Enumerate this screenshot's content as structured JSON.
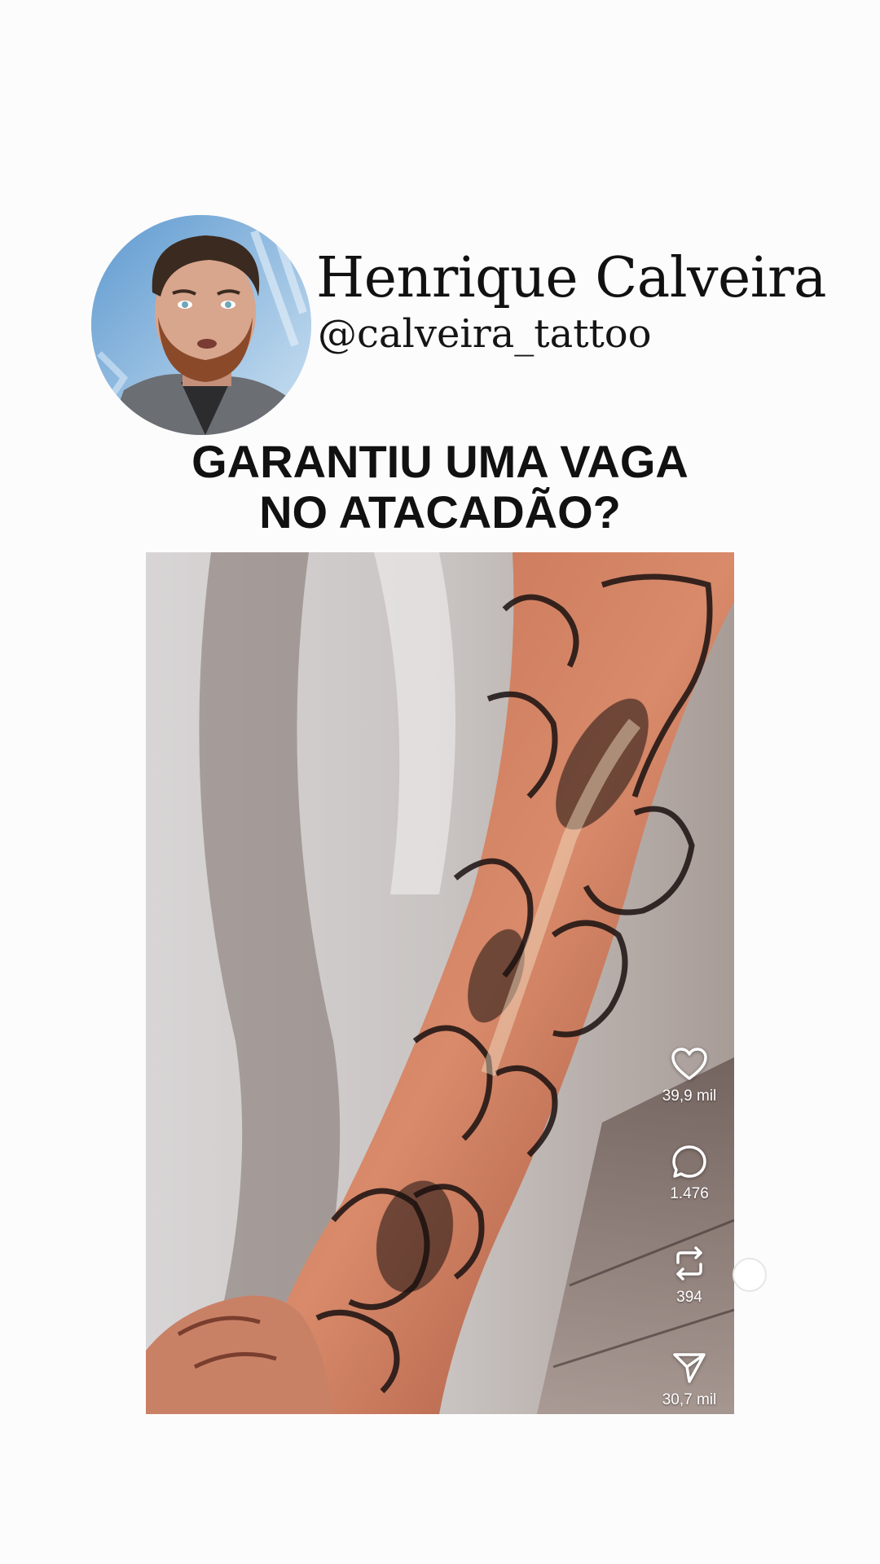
{
  "profile": {
    "name": "Henrique Calveira",
    "handle": "@calveira_tattoo"
  },
  "headline": {
    "line1": "GARANTIU UMA VAGA",
    "line2": "NO ATACADÃO?"
  },
  "video": {
    "actions": {
      "likes": "39,9 mil",
      "comments": "1.476",
      "reposts": "394",
      "shares": "30,7 mil"
    }
  },
  "icons": {
    "like": "heart-icon",
    "comment": "comment-bubble-icon",
    "repost": "repost-icon",
    "share": "send-icon"
  }
}
